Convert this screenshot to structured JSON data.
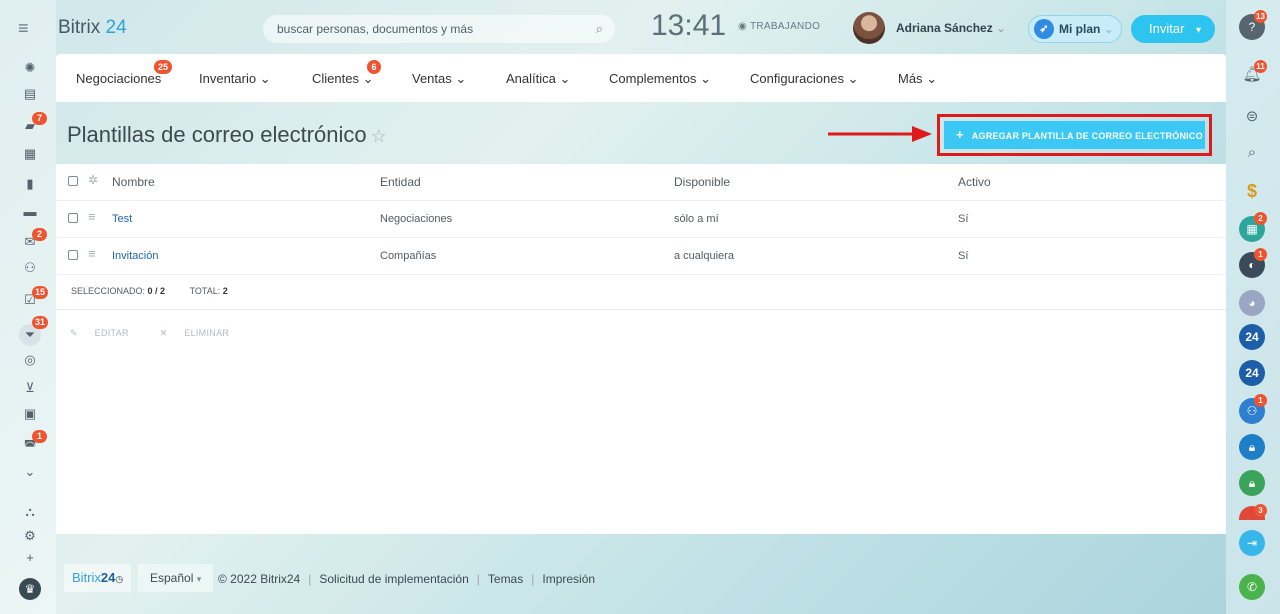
{
  "header": {
    "logo_brand": "Bitrix",
    "logo_num": "24",
    "search_placeholder": "buscar personas, documentos y más",
    "clock": "13:41",
    "work_status": "TRABAJANDO",
    "user_name": "Adriana Sánchez",
    "plan_label": "Mi plan",
    "invite_label": "Invitar"
  },
  "nav": {
    "items": [
      {
        "label": "Negociaciones",
        "badge": "25"
      },
      {
        "label": "Inventario"
      },
      {
        "label": "Clientes",
        "badge": "6"
      },
      {
        "label": "Ventas"
      },
      {
        "label": "Analítica"
      },
      {
        "label": "Complementos"
      },
      {
        "label": "Configuraciones"
      },
      {
        "label": "Más"
      }
    ]
  },
  "page": {
    "title": "Plantillas de correo electrónico",
    "add_button": "AGREGAR PLANTILLA DE CORREO ELECTRÓNICO"
  },
  "table": {
    "columns": [
      "Nombre",
      "Entidad",
      "Disponible",
      "Activo"
    ],
    "rows": [
      {
        "name": "Test",
        "entity": "Negociaciones",
        "available": "sólo a mí",
        "active": "Sí"
      },
      {
        "name": "Invitación",
        "entity": "Compañías",
        "available": "a cualquiera",
        "active": "Sí"
      }
    ],
    "selected_label": "SELECCIONADO:",
    "selected_value": "0 / 2",
    "total_label": "TOTAL:",
    "total_value": "2",
    "edit_label": "EDITAR",
    "delete_label": "ELIMINAR"
  },
  "left_badges": {
    "chat": "7",
    "mail": "2",
    "tasks": "15",
    "crm": "31",
    "robots": "1"
  },
  "right_badges": {
    "help": "13",
    "notifications": "11",
    "user1": "2",
    "user2": "1",
    "group": "1",
    "last": "3"
  },
  "footer": {
    "logo_brand": "Bitrix",
    "logo_num": "24",
    "language": "Español",
    "copyright": "© 2022 Bitrix24",
    "link1": "Solicitud de implementación",
    "link2": "Temas",
    "link3": "Impresión"
  }
}
